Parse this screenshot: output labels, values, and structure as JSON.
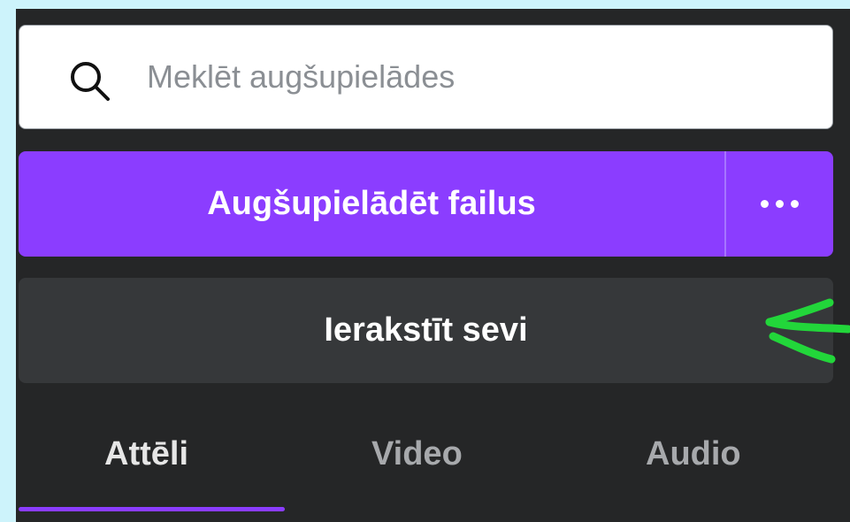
{
  "search": {
    "placeholder": "Meklēt augšupielādes",
    "value": "",
    "icon": "search-icon"
  },
  "upload": {
    "label": "Augšupielādēt failus",
    "more_icon": "more-horizontal-icon",
    "color": "#8b3dff"
  },
  "record": {
    "label": "Ierakstīt sevi"
  },
  "annotation": {
    "icon": "green-arrow-icon",
    "color": "#22d63a"
  },
  "tabs": [
    {
      "label": "Attēli",
      "active": true
    },
    {
      "label": "Video",
      "active": false
    },
    {
      "label": "Audio",
      "active": false
    }
  ],
  "colors": {
    "background": "#cdf3fb",
    "panel": "#252627",
    "record_button": "#36383a",
    "accent": "#8b3dff"
  }
}
